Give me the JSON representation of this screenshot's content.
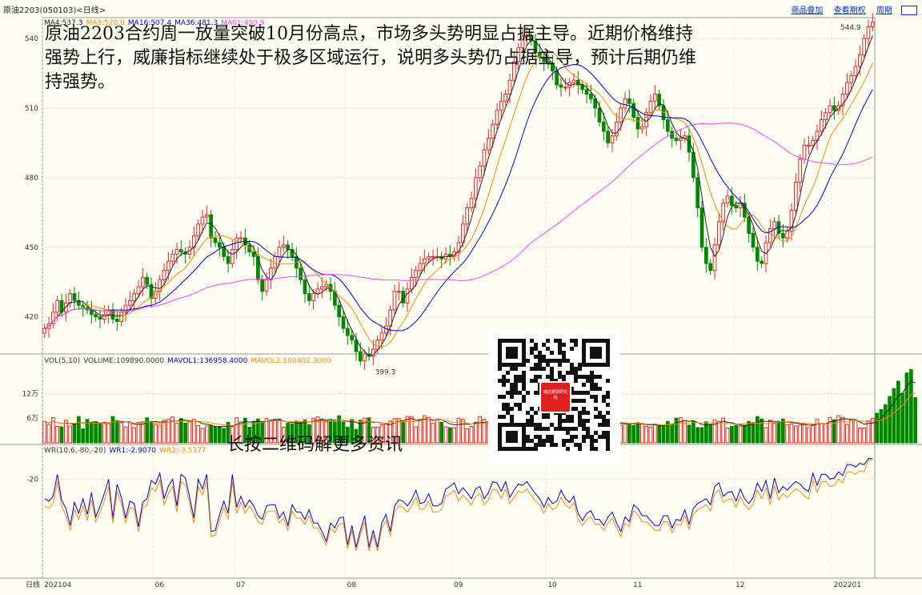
{
  "window": {
    "title": "原油2203(050103)<日线>",
    "links": [
      "商品叠加",
      "查看期权",
      "周期"
    ]
  },
  "headline": "原油2203合约周一放量突破10月份高点，市场多头势明显占据主导。近期价格维持强势上行，威廉指标继续处于极多区域运行，说明多头势仍占据主导，预计后期仍维持强势。",
  "qr_caption": "长按二维码解更多资讯",
  "qr_logo_text": "瑞达期货研究院",
  "ma_legend": [
    {
      "text": "MA4:537.3",
      "color": "#222222"
    },
    {
      "text": "MA9:520.0",
      "color": "#ff8800"
    },
    {
      "text": "MA16:507.4",
      "color": "#0000cc"
    },
    {
      "text": "MA36:481.3",
      "color": "#0000aa"
    },
    {
      "text": "MA61:490.9",
      "color": "#ff44ff"
    }
  ],
  "vol_legend": [
    {
      "text": "VOL(5,10)",
      "color": "#333333"
    },
    {
      "text": "VOLUME:109890.0000",
      "color": "#333333"
    },
    {
      "text": "MAVOL1:136958.4000",
      "color": "#0000cc"
    },
    {
      "text": "MAVOL2:100402.3000",
      "color": "#ff8800"
    }
  ],
  "wr_legend": [
    {
      "text": "WR(10,6,-80,-20)",
      "color": "#333333"
    },
    {
      "text": "WR1:-2.9070",
      "color": "#0000cc"
    },
    {
      "text": "WR2:-3.5377",
      "color": "#ff8800"
    }
  ],
  "bottom_axis_label": "日线",
  "colors": {
    "up": "#ee2222",
    "down": "#008800",
    "ma4": "#222222",
    "ma9": "#ff8800",
    "ma16": "#0000cc",
    "ma61": "#ff44ff",
    "wr1": "#0000cc",
    "wr2": "#ff8800"
  },
  "chart_data": {
    "type": "candlestick",
    "price_axis": {
      "ticks": [
        420,
        450,
        480,
        510,
        540
      ],
      "ylim": [
        404,
        549
      ]
    },
    "volume_axis": {
      "ticks": [
        "6万",
        "12万"
      ],
      "tick_values": [
        60000,
        120000
      ],
      "ylim": [
        0,
        185000
      ]
    },
    "wr_axis": {
      "ticks": [
        "-20"
      ],
      "tick_values": [
        -20
      ],
      "ylim": [
        -100,
        0
      ]
    },
    "x_ticks": [
      {
        "label": "202104",
        "index": 0
      },
      {
        "label": "06",
        "index": 26
      },
      {
        "label": "07",
        "index": 45
      },
      {
        "label": "08",
        "index": 71
      },
      {
        "label": "09",
        "index": 96
      },
      {
        "label": "10",
        "index": 118
      },
      {
        "label": "11",
        "index": 138
      },
      {
        "label": "12",
        "index": 162
      },
      {
        "label": "202201",
        "index": 185
      }
    ],
    "annotations": [
      {
        "text": "544.9",
        "index": 192
      },
      {
        "text": "399.3",
        "index": 83
      }
    ],
    "close": [
      415,
      417,
      422,
      427,
      422,
      426,
      430,
      427,
      425,
      424,
      423,
      421,
      420,
      419,
      421,
      423,
      419,
      418,
      422,
      425,
      427,
      430,
      433,
      437,
      434,
      428,
      431,
      436,
      440,
      444,
      447,
      449,
      448,
      447,
      450,
      455,
      460,
      463,
      464,
      454,
      452,
      450,
      446,
      443,
      449,
      454,
      454,
      451,
      448,
      446,
      436,
      431,
      436,
      441,
      446,
      450,
      451,
      449,
      446,
      441,
      436,
      430,
      427,
      430,
      432,
      433,
      434,
      431,
      425,
      420,
      415,
      412,
      410,
      405,
      401,
      404,
      403,
      406,
      410,
      413,
      416,
      423,
      431,
      431,
      426,
      432,
      437,
      440,
      443,
      445,
      446,
      446,
      446,
      445,
      447,
      446,
      448,
      452,
      460,
      467,
      471,
      480,
      485,
      492,
      497,
      503,
      509,
      513,
      516,
      522,
      530,
      536,
      541,
      541,
      539,
      534,
      532,
      530,
      529,
      526,
      520,
      519,
      519,
      521,
      522,
      520,
      518,
      516,
      514,
      510,
      504,
      500,
      495,
      498,
      504,
      510,
      514,
      512,
      506,
      501,
      502,
      508,
      513,
      516,
      511,
      505,
      500,
      497,
      496,
      497,
      498,
      491,
      480,
      467,
      450,
      443,
      440,
      451,
      461,
      469,
      472,
      468,
      467,
      469,
      463,
      456,
      450,
      444,
      443,
      452,
      458,
      461,
      456,
      454,
      457,
      466,
      478,
      488,
      494,
      494,
      496,
      500,
      505,
      508,
      511,
      509,
      511,
      516,
      521,
      524,
      528,
      533,
      540,
      545,
      547
    ],
    "ma_note": "MA lines are computed in the page from close (periods 4, 9, 16, 36, 61)",
    "volume": [
      52000,
      45000,
      61000,
      40000,
      39000,
      55000,
      41000,
      47000,
      64000,
      34000,
      57000,
      50000,
      51000,
      47000,
      47000,
      47000,
      64000,
      54000,
      49000,
      39000,
      49000,
      37000,
      50000,
      51000,
      61000,
      52000,
      45000,
      43000,
      55000,
      57000,
      63000,
      48000,
      59000,
      48000,
      51000,
      57000,
      42000,
      35000,
      41000,
      42000,
      39000,
      40000,
      35000,
      50000,
      40000,
      61000,
      51000,
      60000,
      38000,
      52000,
      58000,
      51000,
      59000,
      54000,
      57000,
      58000,
      38000,
      48000,
      46000,
      53000,
      51000,
      56000,
      44000,
      59000,
      63000,
      58000,
      51000,
      54000,
      51000,
      66000,
      51000,
      38000,
      57000,
      33000,
      55000,
      60000,
      61000,
      38000,
      38000,
      44000,
      47000,
      53000,
      59000,
      59000,
      51000,
      64000,
      64000,
      39000,
      57000,
      66000,
      62000,
      48000,
      56000,
      50000,
      39000,
      37000,
      37000,
      60000,
      57000,
      34000,
      40000,
      50000,
      64000,
      57000,
      47000,
      63000,
      53000,
      58000,
      35000,
      51000,
      38000,
      43000,
      49000,
      65000,
      54000,
      44000,
      36000,
      64000,
      45000,
      37000,
      59000,
      40000,
      36000,
      52000,
      39000,
      38000,
      60000,
      54000,
      37000,
      61000,
      48000,
      54000,
      39000,
      47000,
      56000,
      43000,
      47000,
      45000,
      42000,
      49000,
      47000,
      40000,
      38000,
      46000,
      43000,
      40000,
      52000,
      45000,
      60000,
      61000,
      54000,
      43000,
      52000,
      37000,
      37000,
      51000,
      45000,
      56000,
      52000,
      60000,
      36000,
      40000,
      43000,
      41000,
      43000,
      52000,
      49000,
      64000,
      58000,
      37000,
      55000,
      47000,
      52000,
      58000,
      44000,
      46000,
      41000,
      43000,
      48000,
      37000,
      44000,
      57000,
      47000,
      46000,
      62000,
      56000,
      66000,
      62000,
      45000,
      55000,
      55000,
      36000,
      36000,
      54000,
      59000,
      72000,
      81000,
      93000,
      113000,
      132000,
      150000,
      120000,
      170000,
      178000,
      109890
    ],
    "wr1": [
      -36,
      -38,
      -34,
      -16,
      -37,
      -44,
      -58,
      -39,
      -48,
      -36,
      -49,
      -31,
      -51,
      -42,
      -32,
      -20,
      -52,
      -24,
      -35,
      -52,
      -38,
      -40,
      -59,
      -39,
      -36,
      -21,
      -24,
      -15,
      -36,
      -26,
      -20,
      -42,
      -16,
      -19,
      -35,
      -52,
      -20,
      -28,
      -16,
      -63,
      -62,
      -49,
      -38,
      -48,
      -16,
      -43,
      -34,
      -43,
      -37,
      -42,
      -50,
      -53,
      -42,
      -41,
      -41,
      -52,
      -47,
      -58,
      -41,
      -47,
      -47,
      -53,
      -45,
      -56,
      -56,
      -63,
      -71,
      -56,
      -60,
      -52,
      -51,
      -74,
      -58,
      -76,
      -62,
      -50,
      -76,
      -62,
      -76,
      -56,
      -49,
      -63,
      -42,
      -37,
      -38,
      -42,
      -37,
      -29,
      -40,
      -39,
      -32,
      -42,
      -42,
      -40,
      -28,
      -26,
      -23,
      -32,
      -27,
      -31,
      -36,
      -28,
      -26,
      -36,
      -31,
      -22,
      -23,
      -30,
      -22,
      -35,
      -29,
      -24,
      -25,
      -22,
      -27,
      -32,
      -36,
      -43,
      -35,
      -40,
      -38,
      -29,
      -36,
      -39,
      -34,
      -48,
      -54,
      -48,
      -46,
      -53,
      -53,
      -58,
      -51,
      -47,
      -56,
      -63,
      -51,
      -55,
      -41,
      -44,
      -50,
      -50,
      -54,
      -58,
      -58,
      -50,
      -50,
      -60,
      -53,
      -54,
      -45,
      -57,
      -44,
      -40,
      -38,
      -36,
      -41,
      -26,
      -23,
      -34,
      -31,
      -30,
      -38,
      -28,
      -36,
      -40,
      -35,
      -23,
      -30,
      -21,
      -36,
      -19,
      -31,
      -26,
      -29,
      -25,
      -22,
      -24,
      -28,
      -30,
      -15,
      -25,
      -16,
      -16,
      -20,
      -19,
      -14,
      -17,
      -8,
      -8,
      -10,
      -7,
      -8,
      -3,
      -3
    ],
    "wr2": [
      -42,
      -44,
      -40,
      -22,
      -42,
      -50,
      -62,
      -45,
      -53,
      -42,
      -54,
      -37,
      -55,
      -47,
      -38,
      -26,
      -56,
      -30,
      -40,
      -56,
      -43,
      -45,
      -63,
      -44,
      -41,
      -27,
      -30,
      -21,
      -41,
      -32,
      -26,
      -47,
      -22,
      -25,
      -40,
      -56,
      -26,
      -33,
      -22,
      -67,
      -66,
      -54,
      -43,
      -53,
      -22,
      -48,
      -39,
      -48,
      -42,
      -47,
      -55,
      -57,
      -47,
      -46,
      -46,
      -56,
      -52,
      -62,
      -46,
      -52,
      -52,
      -57,
      -50,
      -60,
      -60,
      -67,
      -74,
      -60,
      -64,
      -57,
      -56,
      -77,
      -62,
      -79,
      -66,
      -55,
      -79,
      -66,
      -79,
      -60,
      -54,
      -67,
      -47,
      -42,
      -43,
      -47,
      -42,
      -35,
      -45,
      -44,
      -38,
      -47,
      -47,
      -45,
      -34,
      -32,
      -29,
      -38,
      -33,
      -37,
      -41,
      -34,
      -32,
      -41,
      -37,
      -28,
      -29,
      -36,
      -28,
      -40,
      -35,
      -30,
      -31,
      -28,
      -33,
      -38,
      -41,
      -48,
      -40,
      -45,
      -43,
      -35,
      -41,
      -44,
      -39,
      -53,
      -58,
      -53,
      -51,
      -57,
      -57,
      -62,
      -56,
      -52,
      -60,
      -67,
      -56,
      -59,
      -46,
      -49,
      -55,
      -55,
      -58,
      -62,
      -62,
      -55,
      -55,
      -64,
      -57,
      -58,
      -50,
      -61,
      -49,
      -45,
      -43,
      -41,
      -46,
      -32,
      -29,
      -39,
      -37,
      -36,
      -43,
      -34,
      -41,
      -45,
      -40,
      -29,
      -36,
      -27,
      -41,
      -25,
      -37,
      -32,
      -35,
      -31,
      -28,
      -30,
      -34,
      -36,
      -21,
      -31,
      -22,
      -22,
      -26,
      -25,
      -20,
      -23,
      -14,
      -14,
      -16,
      -13,
      -14,
      -4,
      -4
    ]
  }
}
